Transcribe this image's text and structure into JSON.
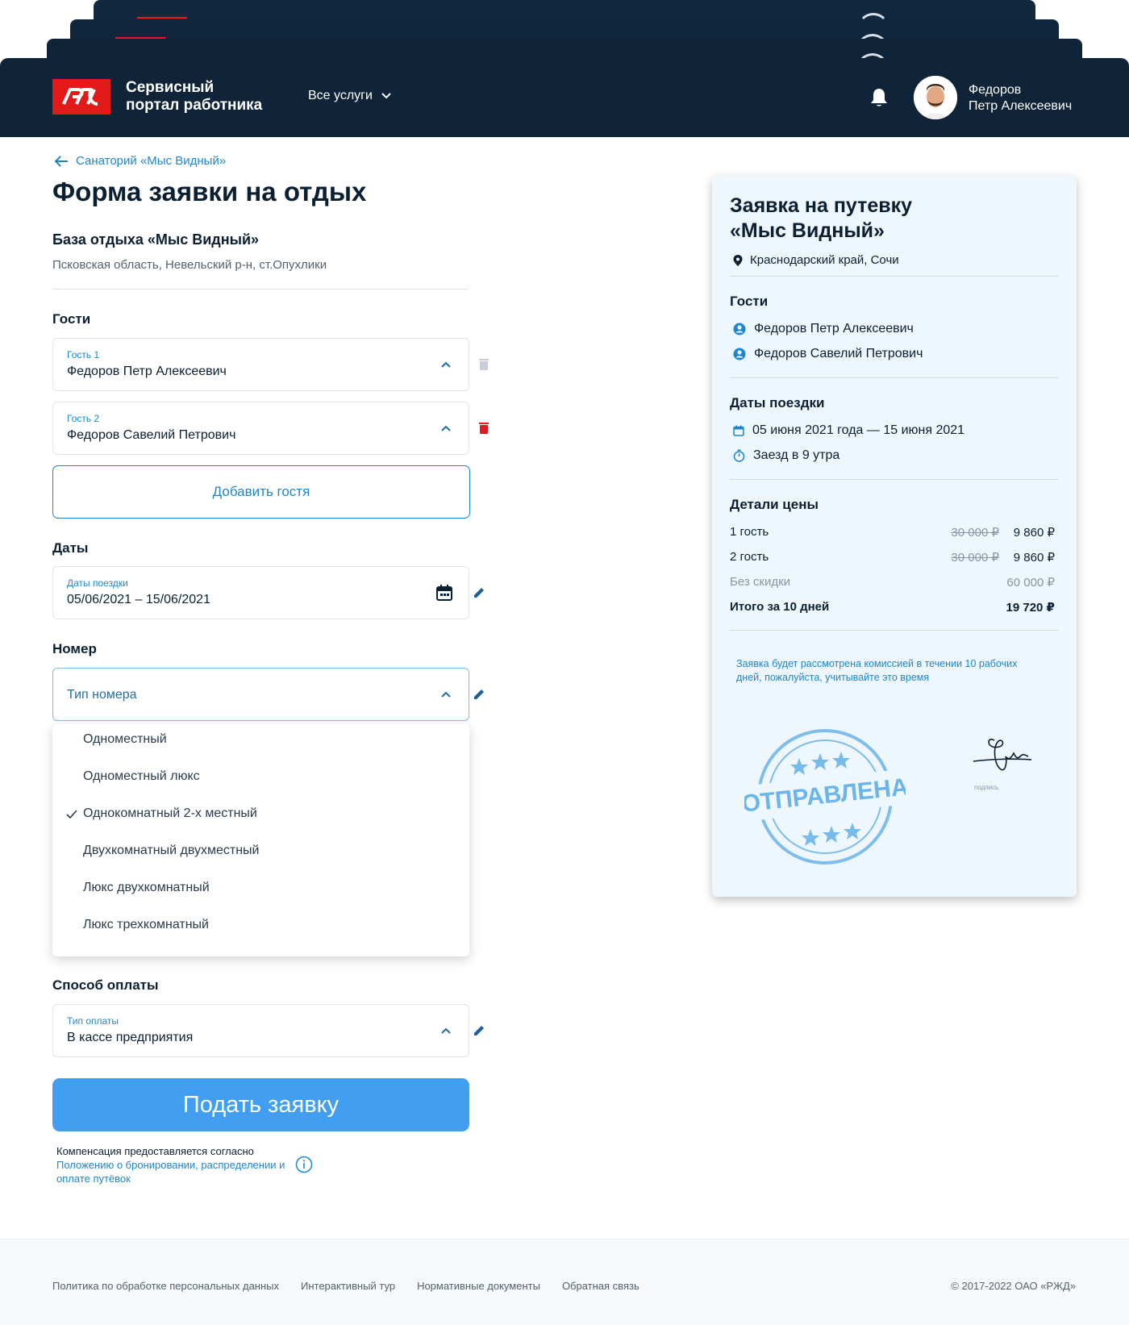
{
  "header": {
    "brand_line1": "Сервисный",
    "brand_line2": "портал работника",
    "services_label": "Все услуги",
    "user_last_name": "Федоров",
    "user_first_patronymic": "Петр Алексеевич"
  },
  "breadcrumb": {
    "back_label": "Санаторий «Мыс Видный»"
  },
  "form": {
    "title": "Форма заявки на отдых",
    "base_title": "База отдыха «Мыс Видный»",
    "base_address": "Псковская область, Невельский р-н, ст.Опухлики",
    "guests_label": "Гости",
    "guests": [
      {
        "label": "Гость 1",
        "value": "Федоров Петр Алексеевич"
      },
      {
        "label": "Гость 2",
        "value": "Федоров Савелий Петрович"
      }
    ],
    "add_guest_label": "Добавить гостя",
    "dates_label": "Даты",
    "dates_field_label": "Даты поездки",
    "dates_value": "05/06/2021 – 15/06/2021",
    "room_label": "Номер",
    "room_placeholder": "Тип номера",
    "room_options": [
      "Одноместный",
      "Одноместный люкс",
      "Однокомнатный 2-х местный",
      "Двухкомнатный двухместный",
      "Люкс двухкомнатный",
      "Люкс трехкомнатный"
    ],
    "room_selected_index": 2,
    "payment_label": "Способ оплаты",
    "payment_field_label": "Тип оплаты",
    "payment_value": "В кассе предприятия",
    "submit_label": "Подать заявку",
    "note_text": "Компенсация предоставляется согласно",
    "note_link": "Положению о бронировании, распределении и оплате путёвок"
  },
  "summary": {
    "title_line1": "Заявка на путевку",
    "title_line2": "«Мыс Видный»",
    "location": "Краснодарский край, Сочи",
    "guests_header": "Гости",
    "guests": [
      "Федоров Петр Алексеевич",
      "Федоров Савелий Петрович"
    ],
    "dates_header": "Даты поездки",
    "dates_value": "05 июня 2021 года — 15 июня 2021",
    "checkin": "Заезд в 9 утра",
    "price_header": "Детали цены",
    "price_rows": [
      {
        "label": "1 гость",
        "old": "30 000 ₽",
        "new": "9 860 ₽"
      },
      {
        "label": "2 гость",
        "old": "30 000 ₽",
        "new": "9 860 ₽"
      }
    ],
    "no_discount_label": "Без скидки",
    "no_discount_value": "60 000 ₽",
    "total_label": "Итого за 10 дней",
    "total_value": "19 720 ₽",
    "review_note": "Заявка будет рассмотрена комиссией в течении 10 рабочих дней, пожалуйста, учитывайте это время",
    "stamp_text": "ОТПРАВЛЕНА",
    "signature_caption": "подпись"
  },
  "footer": {
    "links": [
      "Политика по обработке персональных данных",
      "Интерактивный тур",
      "Нормативные документы",
      "Обратная связь"
    ],
    "copyright": "© 2017-2022 ОАО «РЖД»"
  },
  "colors": {
    "header_bg": "#0f2439",
    "brand_red": "#e21a1a",
    "accent_blue": "#1d86d0",
    "submit_blue": "#429ef0",
    "card_bg": "#eef6fe",
    "delete_red": "#e0191f"
  },
  "icons": {
    "back": "arrow-left-icon",
    "services": "chevron-down-icon",
    "notifications": "bell-icon",
    "delete": "trash-icon",
    "edit": "pencil-icon",
    "calendar": "calendar-icon",
    "location": "map-pin-icon",
    "person": "person-circle-icon",
    "timer": "stopwatch-icon",
    "info": "info-icon"
  }
}
